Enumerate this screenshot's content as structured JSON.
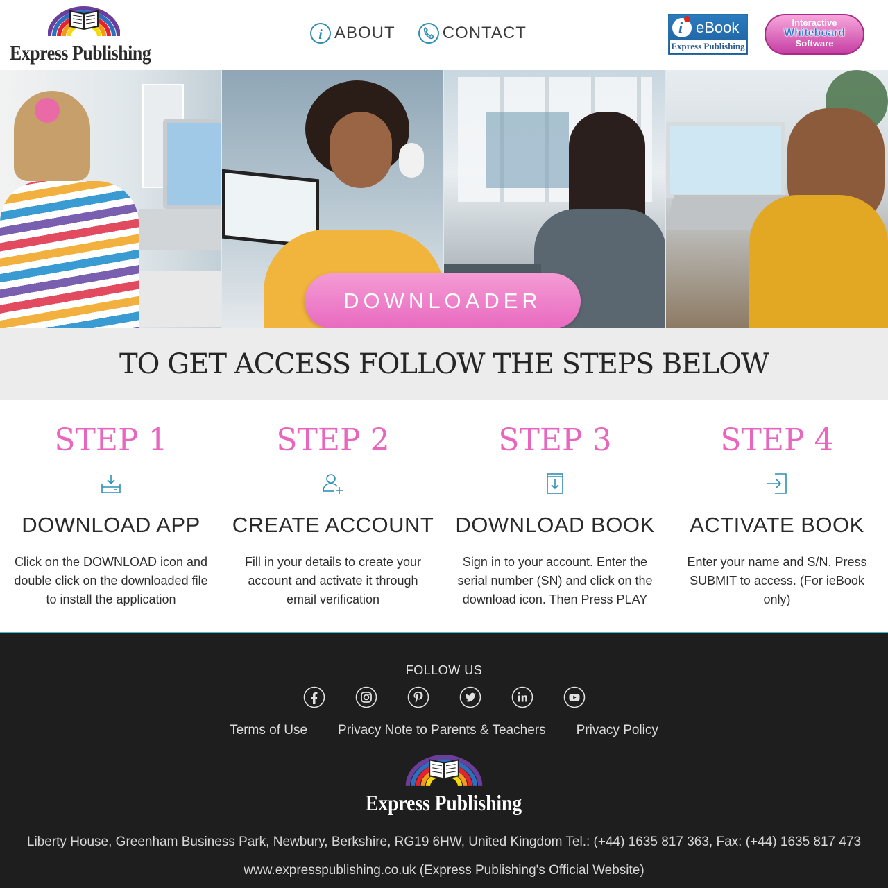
{
  "header": {
    "logo_text": "Express Publishing",
    "nav": [
      {
        "label": "ABOUT",
        "icon": "info-icon"
      },
      {
        "label": "CONTACT",
        "icon": "phone-icon"
      }
    ],
    "ebook_badge": {
      "top": "eBook",
      "bottom": "Express Publishing"
    },
    "iwb_badge": {
      "line1": "Interactive",
      "line2": "Whiteboard",
      "line3": "Software"
    }
  },
  "hero": {
    "cta_label": "DOWNLOADER"
  },
  "steps_title": "TO GET ACCESS FOLLOW THE STEPS BELOW",
  "steps": [
    {
      "number": "STEP 1",
      "icon": "download-tray-icon",
      "title": "DOWNLOAD APP",
      "desc": "Click on the DOWNLOAD icon and double click on the downloaded file to install the application"
    },
    {
      "number": "STEP 2",
      "icon": "add-user-icon",
      "title": "CREATE ACCOUNT",
      "desc": "Fill in your details to create your account and activate it through email verification"
    },
    {
      "number": "STEP 3",
      "icon": "download-book-icon",
      "title": "DOWNLOAD BOOK",
      "desc": "Sign in to your account. Enter the serial number (SN) and click on the download icon. Then Press PLAY"
    },
    {
      "number": "STEP 4",
      "icon": "sign-in-icon",
      "title": "ACTIVATE BOOK",
      "desc": "Enter your name and S/N. Press SUBMIT to access. (For ieBook only)"
    }
  ],
  "footer": {
    "follow_label": "FOLLOW US",
    "socials": [
      "facebook-icon",
      "instagram-icon",
      "pinterest-icon",
      "twitter-icon",
      "linkedin-icon",
      "youtube-icon"
    ],
    "links": [
      "Terms of Use",
      "Privacy Note to Parents & Teachers",
      "Privacy Policy"
    ],
    "logo_text": "Express Publishing",
    "address": "Liberty House, Greenham Business Park, Newbury, Berkshire, RG19 6HW, United Kingdom Tel.: (+44) 1635 817 363, Fax: (+44) 1635 817 473",
    "website": "www.expresspublishing.co.uk (Express Publishing's Official Website)"
  },
  "colors": {
    "accent_pink": "#e866be",
    "teal_line": "#3cc1c6",
    "footer_bg": "#1e1e1e",
    "icon_blue": "#2e8fb5"
  }
}
